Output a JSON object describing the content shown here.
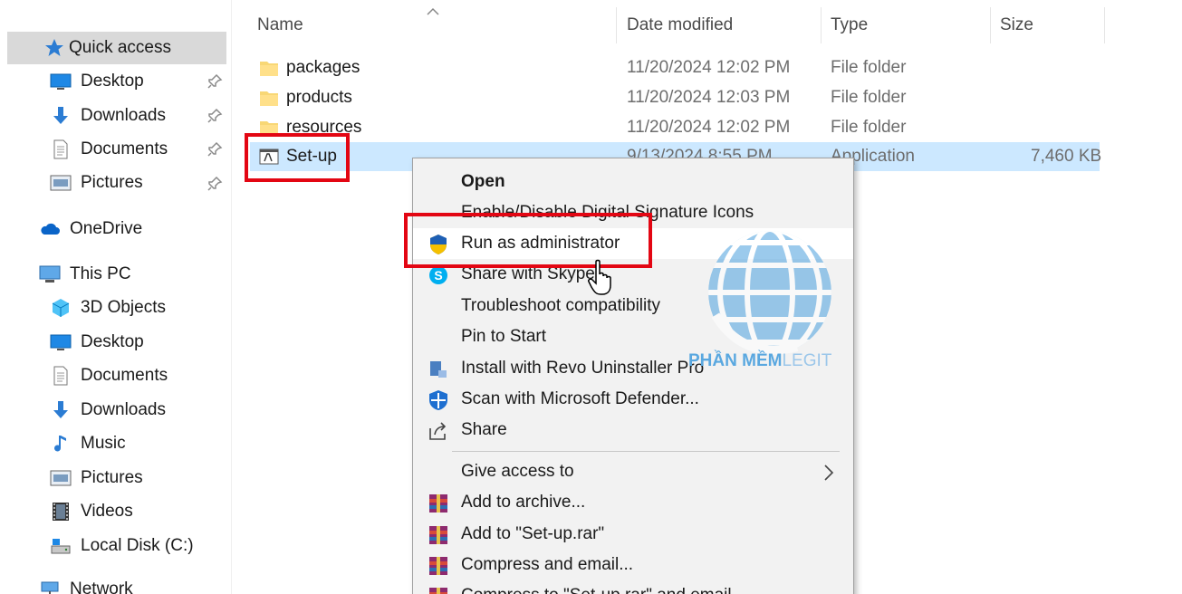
{
  "nav": {
    "quick_access": "Quick access",
    "quick_items": [
      "Desktop",
      "Downloads",
      "Documents",
      "Pictures"
    ],
    "onedrive": "OneDrive",
    "this_pc": "This PC",
    "pc_items": [
      "3D Objects",
      "Desktop",
      "Documents",
      "Downloads",
      "Music",
      "Pictures",
      "Videos",
      "Local Disk (C:)"
    ],
    "network": "Network"
  },
  "columns": {
    "name": "Name",
    "date": "Date modified",
    "type": "Type",
    "size": "Size"
  },
  "files": [
    {
      "name": "packages",
      "date": "11/20/2024 12:02 PM",
      "type": "File folder",
      "size": "",
      "icon": "folder-icon"
    },
    {
      "name": "products",
      "date": "11/20/2024 12:03 PM",
      "type": "File folder",
      "size": "",
      "icon": "folder-icon"
    },
    {
      "name": "resources",
      "date": "11/20/2024 12:02 PM",
      "type": "File folder",
      "size": "",
      "icon": "folder-icon"
    },
    {
      "name": "Set-up",
      "date": "9/13/2024 8:55 PM",
      "type": "Application",
      "size": "7,460 KB",
      "icon": "application-icon",
      "selected": true
    }
  ],
  "context_menu": {
    "open": "Open",
    "digital_signature": "Enable/Disable Digital Signature Icons",
    "run_as_admin": "Run as administrator",
    "share_skype": "Share with Skype",
    "troubleshoot": "Troubleshoot compatibility",
    "pin_start": "Pin to Start",
    "revo": "Install with Revo Uninstaller Pro",
    "defender": "Scan with Microsoft Defender...",
    "share": "Share",
    "give_access": "Give access to",
    "add_archive": "Add to archive...",
    "add_rar": "Add to \"Set-up.rar\"",
    "compress_email": "Compress and email...",
    "compress_rar_email": "Compress to \"Set-up.rar\" and email"
  },
  "watermark": {
    "brand": "PHẦN MỀM",
    "suffix": "LEGIT"
  },
  "colors": {
    "highlight": "#e30613",
    "selection": "#cce8ff",
    "nav_active": "#d9d9d9",
    "menu_bg": "#f2f2f2"
  }
}
